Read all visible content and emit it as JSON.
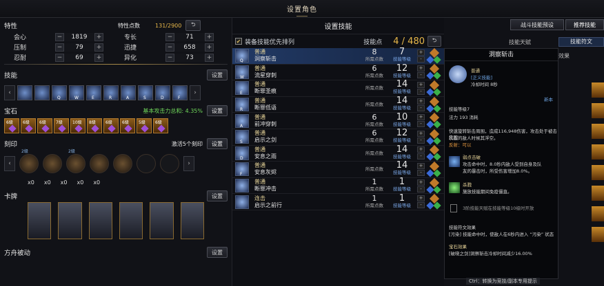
{
  "title": "设置角色",
  "left": {
    "traits_label": "特性",
    "traits_points_label": "特性点数",
    "traits_points": "131/2900",
    "stats": [
      {
        "a": {
          "name": "会心",
          "value": "1819"
        },
        "b": {
          "name": "专长",
          "value": "71"
        }
      },
      {
        "a": {
          "name": "压制",
          "value": "79"
        },
        "b": {
          "name": "迅捷",
          "value": "658"
        }
      },
      {
        "a": {
          "name": "忍耐",
          "value": "69"
        },
        "b": {
          "name": "异化",
          "value": "73"
        }
      }
    ],
    "skills_label": "技能",
    "set": "设置",
    "skill_keys": [
      "",
      "",
      "Q",
      "W",
      "E",
      "R",
      "A",
      "S",
      "D",
      "F"
    ],
    "gems_label": "宝石",
    "gems_bonus": "基本攻击力总和: 4.35%",
    "gem_levels": [
      "6级",
      "6级",
      "6级",
      "7级",
      "10级",
      "8级",
      "6级",
      "6级",
      "5级",
      "6级"
    ],
    "engrave_label": "刻印",
    "engrave_hint": "激活5个刻印",
    "engrave_levels": [
      "2级",
      "",
      "2级",
      "",
      "",
      "",
      ""
    ],
    "x_counts": [
      "x0",
      "x0",
      "x0",
      "x0",
      "x0"
    ],
    "cards_label": "卡牌",
    "ark_label": "方舟被动"
  },
  "center": {
    "title": "设置技能",
    "option": "装备技能优先排列",
    "skill_points_label": "技能点",
    "skill_points": "4 / 480",
    "used_label": "所需点数",
    "level_label": "技能等级",
    "plus": "+",
    "minus": "-",
    "skills": [
      {
        "type": "普通",
        "name": "洞察斩击",
        "used": "8",
        "level": "7",
        "key": "Q"
      },
      {
        "type": "普通",
        "name": "流星穿刺",
        "used": "6",
        "level": "12",
        "key": "W"
      },
      {
        "type": "普通",
        "name": "断罪圣痕",
        "used": "",
        "level": "14",
        "key": "E"
      },
      {
        "type": "普通",
        "name": "断罪低语",
        "used": "",
        "level": "14",
        "key": "R"
      },
      {
        "type": "普通",
        "name": "前冲穿刺",
        "used": "6",
        "level": "10",
        "key": "A"
      },
      {
        "type": "普通",
        "name": "启示之剑",
        "used": "6",
        "level": "12",
        "key": "S"
      },
      {
        "type": "普通",
        "name": "安息之雨",
        "used": "",
        "level": "14",
        "key": "D"
      },
      {
        "type": "普通",
        "name": "安息灰烬",
        "used": "",
        "level": "14",
        "key": "F"
      },
      {
        "type": "普通",
        "name": "断罪冲击",
        "used": "1",
        "level": "1",
        "key": ""
      },
      {
        "type": "连击",
        "name": "启示之前行",
        "used": "1",
        "level": "1",
        "key": ""
      }
    ]
  },
  "right": {
    "preset": "战斗技能预设",
    "recommend": "推荐技能",
    "tab1": "技能天赋",
    "tab2": "技能符文",
    "tab3": "效果"
  },
  "tooltip": {
    "name": "洞察斩击",
    "type": "普通",
    "tag": "[正义技能]",
    "cooldown": "冷却时间 8秒",
    "more": "新本",
    "lv": "技能等级7",
    "mp": "法力 193 消耗",
    "desc1": "快速旋转斩击周围，造成116,948伤害，攻击处于被击先腔",
    "desc2": "状态的敌人时候其浮空。",
    "stagger": "反射：可以",
    "t1": "弱点击破",
    "t1d": "攻击命中时，8.0秒内敌人受到自身及队",
    "t1d2": "友的暴击时，所受伤害增加8.0%。",
    "t2": "杀戮",
    "t2d": "施放技能期间免疫僵直。",
    "t3": "3阶技能天赋在技能等级10级时开放",
    "rune": "技能符文效果",
    "rune_d": "[污染] 技能命中时，使敌人在6秒内进入 “污染” 状态",
    "gem": "宝石效果",
    "gem_d": "[破晓之剑]洞察斩击冷却时间减少16.00%",
    "foot": "Ctrl：转换为竞技/副本专用提示"
  },
  "colors": {
    "accent": "#e8b84a",
    "gold": "#e8d59a",
    "blue": "#79a6e6"
  }
}
